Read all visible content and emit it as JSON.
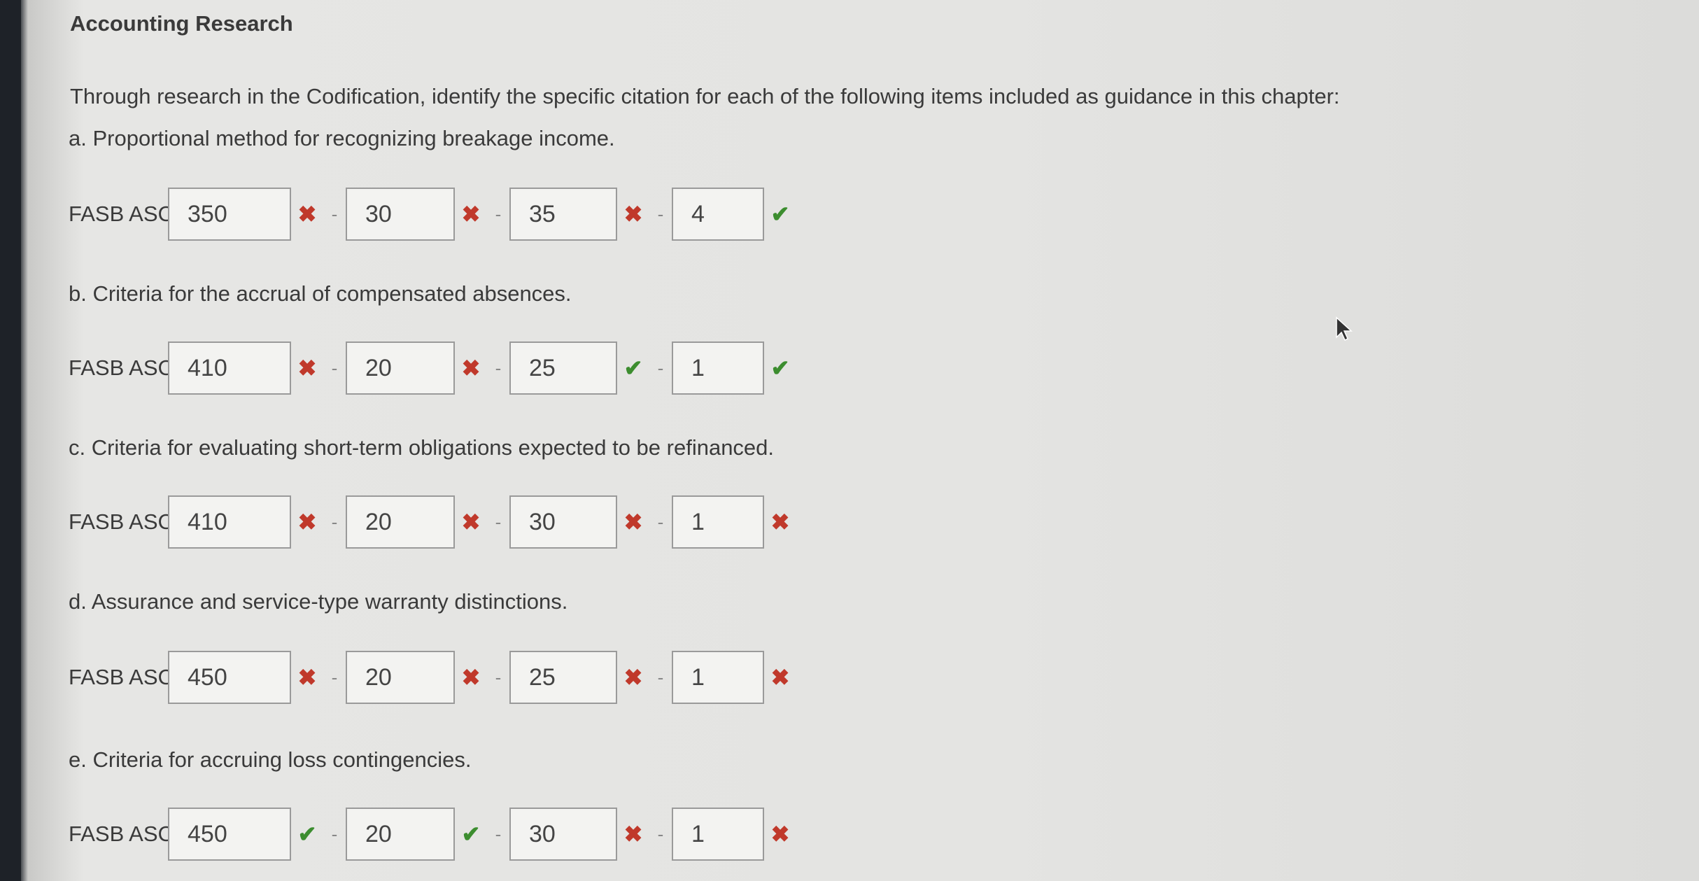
{
  "title": "Accounting Research",
  "intro": "Through research in the Codification, identify the specific citation for each of the following items included as guidance in this chapter:",
  "prefix": "FASB ASC",
  "separator": "-",
  "items": [
    {
      "label": "a. Proportional method for recognizing breakage income.",
      "fields": [
        {
          "value": "350",
          "status": "incorrect"
        },
        {
          "value": "30",
          "status": "incorrect"
        },
        {
          "value": "35",
          "status": "incorrect"
        },
        {
          "value": "4",
          "status": "correct"
        }
      ]
    },
    {
      "label": "b. Criteria for the accrual of compensated absences.",
      "fields": [
        {
          "value": "410",
          "status": "incorrect"
        },
        {
          "value": "20",
          "status": "incorrect"
        },
        {
          "value": "25",
          "status": "correct"
        },
        {
          "value": "1",
          "status": "correct"
        }
      ]
    },
    {
      "label": "c. Criteria for evaluating short-term obligations expected to be refinanced.",
      "fields": [
        {
          "value": "410",
          "status": "incorrect"
        },
        {
          "value": "20",
          "status": "incorrect"
        },
        {
          "value": "30",
          "status": "incorrect"
        },
        {
          "value": "1",
          "status": "incorrect"
        }
      ]
    },
    {
      "label": "d. Assurance and service-type warranty distinctions.",
      "fields": [
        {
          "value": "450",
          "status": "incorrect"
        },
        {
          "value": "20",
          "status": "incorrect"
        },
        {
          "value": "25",
          "status": "incorrect"
        },
        {
          "value": "1",
          "status": "incorrect"
        }
      ]
    },
    {
      "label": "e. Criteria for accruing loss contingencies.",
      "fields": [
        {
          "value": "450",
          "status": "correct"
        },
        {
          "value": "20",
          "status": "correct"
        },
        {
          "value": "30",
          "status": "incorrect"
        },
        {
          "value": "1",
          "status": "incorrect"
        }
      ]
    }
  ],
  "icons": {
    "correct": "check-icon",
    "incorrect": "x-icon"
  },
  "colors": {
    "correct": "#3c8d2f",
    "incorrect": "#c0392b"
  }
}
